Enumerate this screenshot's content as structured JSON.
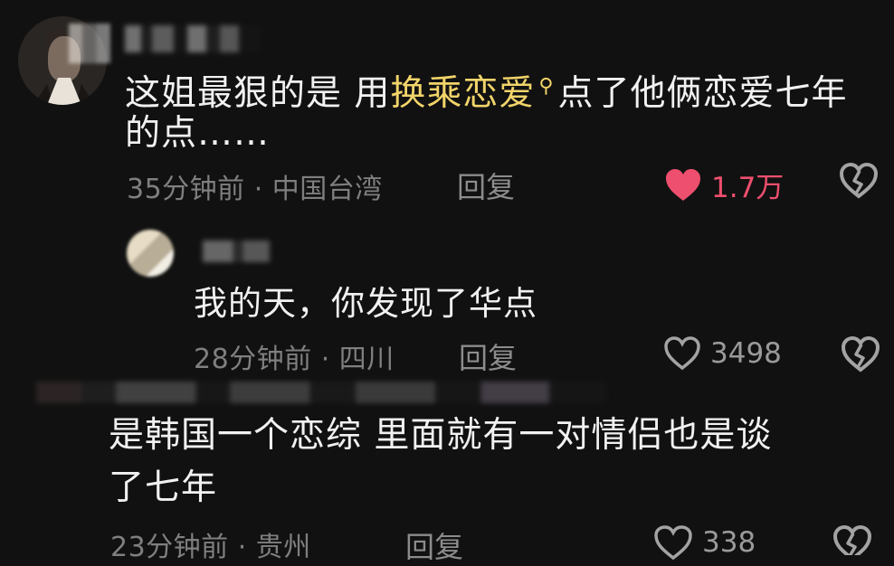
{
  "comments": [
    {
      "text_before": "这姐最狠的是 用",
      "highlight": "换乘恋爱",
      "text_after_line1": "点了他俩恋爱七年",
      "text_line2": "的点……",
      "meta": "35分钟前 · 中国台湾",
      "reply_label": "回复",
      "likes": "1.7万",
      "liked": true,
      "like_color": "#ef4f6e"
    },
    {
      "text": "我的天，你发现了华点",
      "meta": "28分钟前 · 四川",
      "reply_label": "回复",
      "likes": "3498",
      "liked": false
    },
    {
      "text_line1": "是韩国一个恋综 里面就有一对情侣也是谈",
      "text_line2": "了七年",
      "meta": "23分钟前 · 贵州",
      "reply_label": "回复",
      "likes": "338",
      "liked": false
    }
  ],
  "colors": {
    "background": "#111111",
    "text": "#f1f1f1",
    "meta": "#7f7f7f",
    "highlight": "#f1d46a",
    "like_active": "#ef4f6e"
  },
  "icons": {
    "search": "search-icon",
    "heart": "heart-icon",
    "broken_heart": "broken-heart-icon"
  }
}
